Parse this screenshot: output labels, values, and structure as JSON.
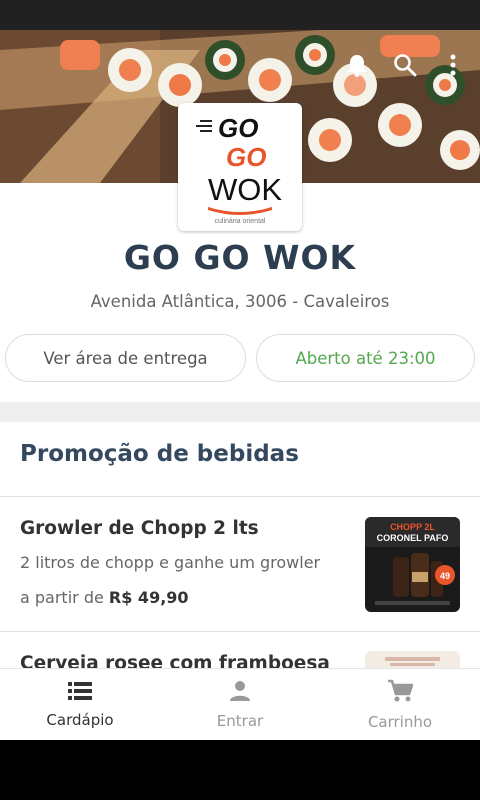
{
  "header": {
    "icons": [
      "bell-icon",
      "search-icon",
      "more-vert-icon"
    ],
    "logo": {
      "line1": "GO",
      "line2": "GO",
      "line3": "WOK",
      "tagline": "culinária oriental"
    }
  },
  "store": {
    "name": "GO GO WOK",
    "address": "Avenida Atlântica, 3006 - Cavaleiros",
    "delivery_area_label": "Ver área de entrega",
    "open_status": "Aberto até 23:00"
  },
  "section": {
    "title": "Promoção de bebidas",
    "items": [
      {
        "name": "Growler de Chopp 2 lts",
        "description": "2 litros de chopp e ganhe um growler",
        "price_prefix": "a partir de",
        "price": "R$ 49,90",
        "thumb": {
          "line1": "CHOPP 2L",
          "line2": "CORONEL PAFO",
          "badge": "49"
        }
      },
      {
        "name": "Cerveja rosee com framboesa",
        "description": "",
        "price_prefix": "",
        "price": ""
      }
    ]
  },
  "bottom_nav": [
    {
      "label": "Cardápio",
      "icon": "list-icon",
      "active": true
    },
    {
      "label": "Entrar",
      "icon": "person-icon",
      "active": false
    },
    {
      "label": "Carrinho",
      "icon": "cart-icon",
      "active": false
    }
  ],
  "colors": {
    "title": "#2c3e50",
    "open_green": "#55a84f",
    "logo_orange": "#e8552b",
    "status_bar": "#212121"
  }
}
